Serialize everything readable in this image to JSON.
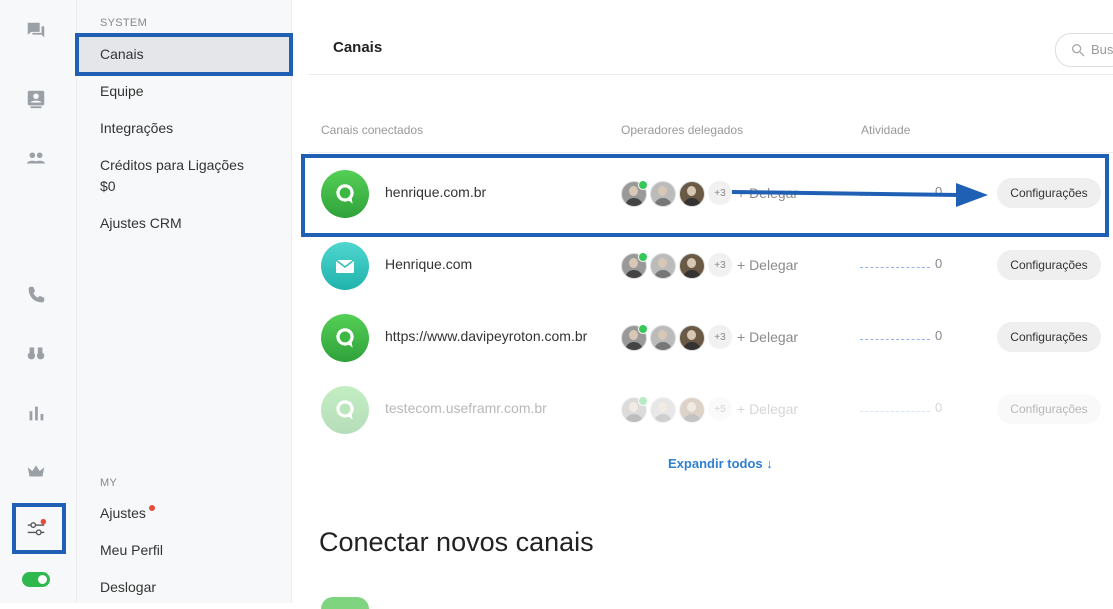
{
  "rail": {
    "icons": [
      "chat-icon",
      "contacts-icon",
      "team-icon",
      "phone-icon",
      "binoculars-icon",
      "bar-chart-icon",
      "crown-icon",
      "settings-sliders-icon",
      "toggle-icon"
    ]
  },
  "sidebar": {
    "system_label": "SYSTEM",
    "items": [
      {
        "label": "Canais",
        "active": true
      },
      {
        "label": "Equipe"
      },
      {
        "label": "Integrações"
      },
      {
        "label": "Créditos para Ligações"
      },
      {
        "label": "Ajustes CRM"
      }
    ],
    "credits_value": "$0",
    "my_label": "MY",
    "my_items": [
      {
        "label": "Ajustes"
      },
      {
        "label": "Meu Perfil"
      },
      {
        "label": "Deslogar"
      }
    ]
  },
  "header": {
    "title": "Canais",
    "search_text": "Bus"
  },
  "table": {
    "columns": [
      "Canais conectados",
      "Operadores delegados",
      "Atividade"
    ],
    "rows": [
      {
        "name": "henrique.com.br",
        "icon": "chat-bubble-icon",
        "more": "+3",
        "delegate": "+ Delegar",
        "activity": "0",
        "button": "Configurações"
      },
      {
        "name": "Henrique.com",
        "icon": "mail-icon",
        "more": "+3",
        "delegate": "+ Delegar",
        "activity": "0",
        "button": "Configurações"
      },
      {
        "name": "https://www.davipeyroton.com.br",
        "icon": "chat-bubble-icon",
        "more": "+3",
        "delegate": "+ Delegar",
        "activity": "0",
        "button": "Configurações"
      },
      {
        "name": "testecom.useframr.com.br",
        "icon": "chat-bubble-icon",
        "more": "+5",
        "delegate": "+ Delegar",
        "activity": "0",
        "button": "Configurações"
      }
    ]
  },
  "expand_label": "Expandir todos ↓",
  "connect_title": "Conectar novos canais",
  "colors": {
    "highlight": "#1f5fb4",
    "link": "#2f80d1",
    "green": "#34c759"
  }
}
